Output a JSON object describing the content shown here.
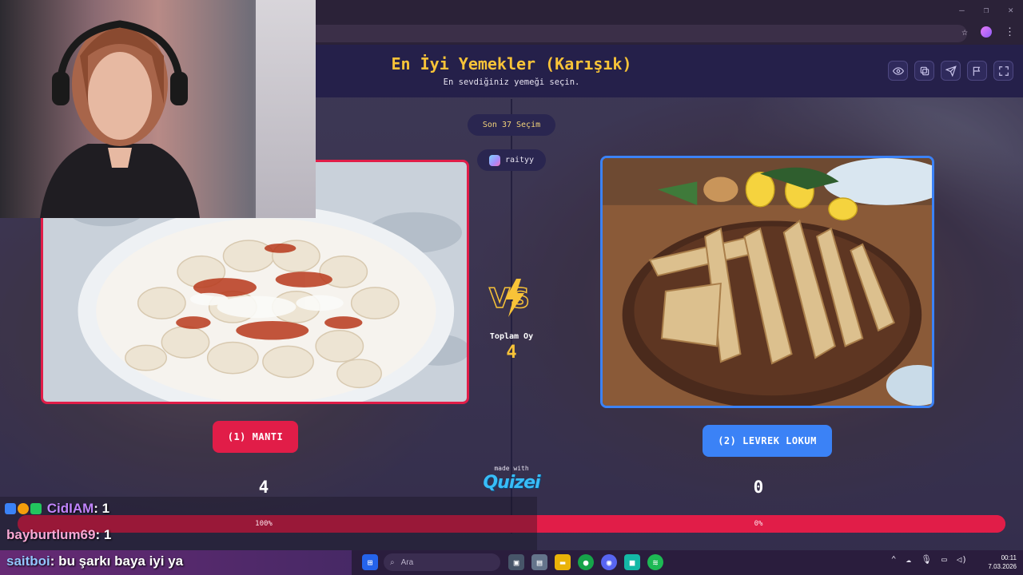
{
  "browser": {
    "window_controls": [
      "—",
      "❐",
      "✕"
    ],
    "icons": [
      "star-icon",
      "extension-icon",
      "menu-icon"
    ]
  },
  "quiz": {
    "title": "En İyi Yemekler (Karışık)",
    "subtitle": "En sevdiğiniz yemeği seçin.",
    "header_buttons": [
      "eye-icon",
      "copy-icon",
      "send-icon",
      "flag-icon",
      "fullscreen-icon"
    ],
    "last_choices": "Son 37 Seçim",
    "user": "raityy",
    "total_votes_label": "Toplam Oy",
    "total_votes": "4",
    "made_with": "made with",
    "brand": "Quizei"
  },
  "options": [
    {
      "label": "(1) MANTI",
      "votes": "4",
      "percent_text": "100%",
      "percent": 100,
      "color": "#e11d48"
    },
    {
      "label": "(2) LEVREK LOKUM",
      "votes": "0",
      "percent_text": "0%",
      "percent": 0,
      "color": "#3b82f6"
    }
  ],
  "chat": [
    {
      "user": "CidIAM",
      "text": ": 1",
      "color": "#c084fc"
    },
    {
      "user": "bayburtlum69",
      "text": ": 1",
      "color": "#f9a8d4"
    },
    {
      "user": "saitboi",
      "text": ": bu şarkı baya iyi ya",
      "color": "#93c5fd"
    }
  ],
  "taskbar": {
    "search_placeholder": "Ara",
    "time": "00:11",
    "date": "7.03.2026"
  }
}
